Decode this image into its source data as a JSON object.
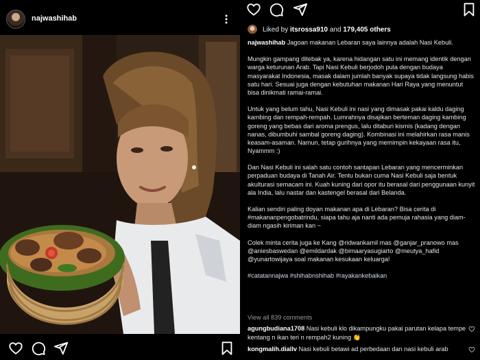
{
  "post": {
    "username": "najwashihab"
  },
  "likes": {
    "prefix": "Liked by",
    "user": "itsrossa910",
    "middle": "and",
    "others": "179,405 others"
  },
  "caption": {
    "username": "najwashihab",
    "paragraphs": [
      "Jagoan makanan Lebaran saya lainnya adalah Nasi Kebuli.",
      "Mungkin gampang ditebak ya, karena hidangan satu ini memang identik dengan warga keturunan Arab. Tapi Nasi Kebuli berjodoh pula dengan budaya masyarakat Indonesia, masak dalam jumlah banyak supaya tidak langsung habis satu hari. Sesuai juga dengan kebutuhan makanan Hari Raya yang menuntut bisa dinikmati ramai-ramai.",
      "Untuk yang belum tahu, Nasi Kebuli ini nasi yang dimasak pakai kaldu daging kambing dan rempah-rempah. Lumrahnya disajikan berteman daging kambing goreng yang bebas dari aroma prengus, lalu ditaburi kismis (kadang dengan nanas, dibumbuhi sambal goreng daging). Kombinasi ini melahirkan rasa manis keasam-asaman. Namun, tetap gurihnya yang memimpin kekayaan rasa itu, Nyammm :)",
      "Dan Nasi Kebuli ini salah satu contoh santapan Lebaran yang mencerminkan perpaduan budaya di Tanah Air. Tentu bukan cuma Nasi Kebuli saja bentuk akulturasi semacam ini. Kuah kuning dari opor itu berasal dari penggunaan kunyit ala India, lalu nastar dan kastengel berasal dari Belanda.",
      "Kalian sendiri paling doyan makanan apa di Lebaran? Bisa cerita di #makananpengobatrindu, siapa tahu aja nanti ada pemuja rahasia yang diam-diam ngasih kiriman kan ~",
      "Colek minta cerita juga ke Kang @ridwankamil mas @ganjar_pranowo mas @aniesbaswedan @emildardak @bimaaryasugiarto @meutya_hafid @yunartowijaya soal makanan kesukaan keluarga!",
      "#catatannajwa #shihabnshihab #rayakankebaikan"
    ]
  },
  "comments_link": "View all 839 comments",
  "comments": [
    {
      "username": "agungbudiana1708",
      "text": "Nasi kebuli klo dikampungku pakai parutan kelapa tempe kentang n ikan teri n rempah2 kuning 👏"
    },
    {
      "username": "kongmalih.diallv",
      "text": "Nasi kebuli betawi ad perbedaan dan nasi kebuli arab"
    }
  ],
  "icons": {
    "heart": "heart-icon",
    "comment": "comment-icon",
    "share": "send-icon",
    "save": "bookmark-icon",
    "more": "more-icon"
  }
}
